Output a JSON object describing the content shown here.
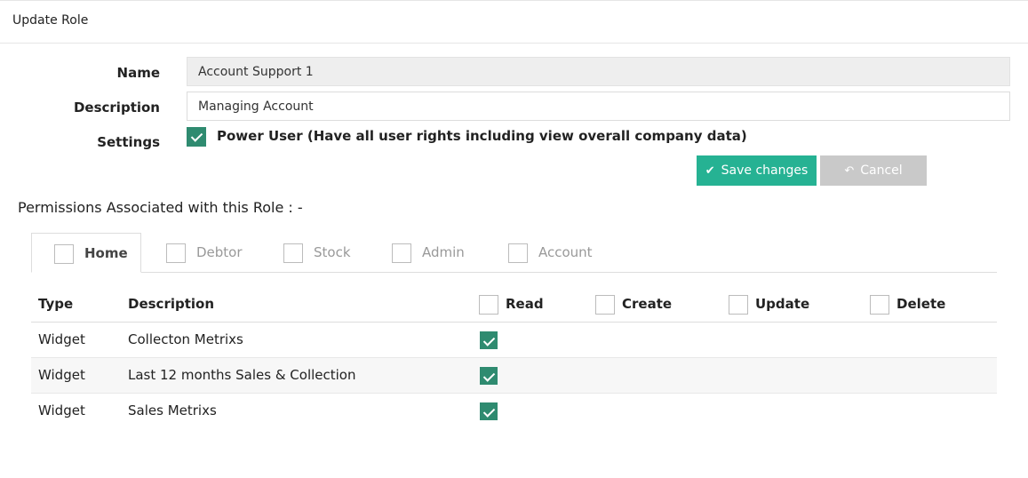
{
  "header": {
    "title": "Update Role"
  },
  "form": {
    "name_label": "Name",
    "name_value": "Account Support 1",
    "description_label": "Description",
    "description_value": "Managing Account",
    "settings_label": "Settings",
    "power_user_label": "Power User (Have all user rights including view overall company data)",
    "power_user_checked": true
  },
  "actions": {
    "save_label": "Save changes",
    "cancel_label": "Cancel",
    "save_color": "#26b293",
    "cancel_color": "#c9c9c9"
  },
  "permissions": {
    "title": "Permissions Associated with this Role : -",
    "tabs": [
      {
        "label": "Home",
        "active": true
      },
      {
        "label": "Debtor",
        "active": false
      },
      {
        "label": "Stock",
        "active": false
      },
      {
        "label": "Admin",
        "active": false
      },
      {
        "label": "Account",
        "active": false
      }
    ],
    "columns": {
      "type": "Type",
      "description": "Description",
      "read": "Read",
      "create": "Create",
      "update": "Update",
      "delete": "Delete"
    },
    "rows": [
      {
        "type": "Widget",
        "description": "Collecton Metrixs",
        "read": true
      },
      {
        "type": "Widget",
        "description": "Last 12 months Sales & Collection",
        "read": true
      },
      {
        "type": "Widget",
        "description": "Sales Metrixs",
        "read": true
      }
    ]
  },
  "colors": {
    "check_on": "#2f8b70"
  }
}
